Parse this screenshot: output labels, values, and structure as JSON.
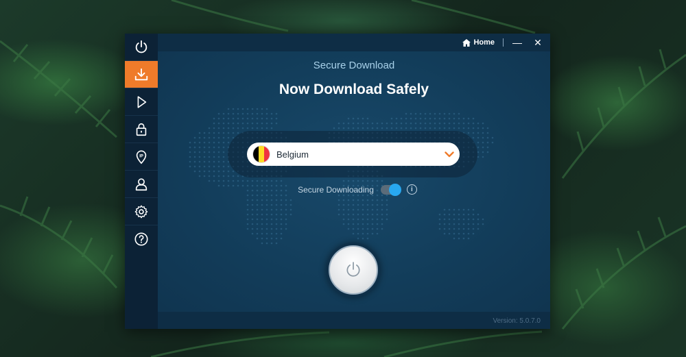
{
  "titlebar": {
    "home_label": "Home",
    "minimize_glyph": "—",
    "close_glyph": "✕"
  },
  "sidebar": {
    "items": [
      {
        "icon": "power-icon",
        "active": false
      },
      {
        "icon": "download-icon",
        "active": true
      },
      {
        "icon": "play-icon",
        "active": false
      },
      {
        "icon": "lock-icon",
        "active": false
      },
      {
        "icon": "ip-pin-icon",
        "active": false
      },
      {
        "icon": "user-icon",
        "active": false
      },
      {
        "icon": "gear-icon",
        "active": false
      },
      {
        "icon": "help-icon",
        "active": false
      }
    ]
  },
  "main": {
    "subtitle": "Secure Download",
    "title": "Now Download Safely",
    "location": {
      "name": "Belgium",
      "flag_colors": [
        "#000000",
        "#fdda24",
        "#ef3340"
      ]
    },
    "toggle": {
      "label": "Secure Downloading",
      "on": true
    }
  },
  "footer": {
    "version": "Version: 5.0.7.0"
  },
  "colors": {
    "accent": "#ef7b2a",
    "toggle_on": "#28a8f0"
  }
}
